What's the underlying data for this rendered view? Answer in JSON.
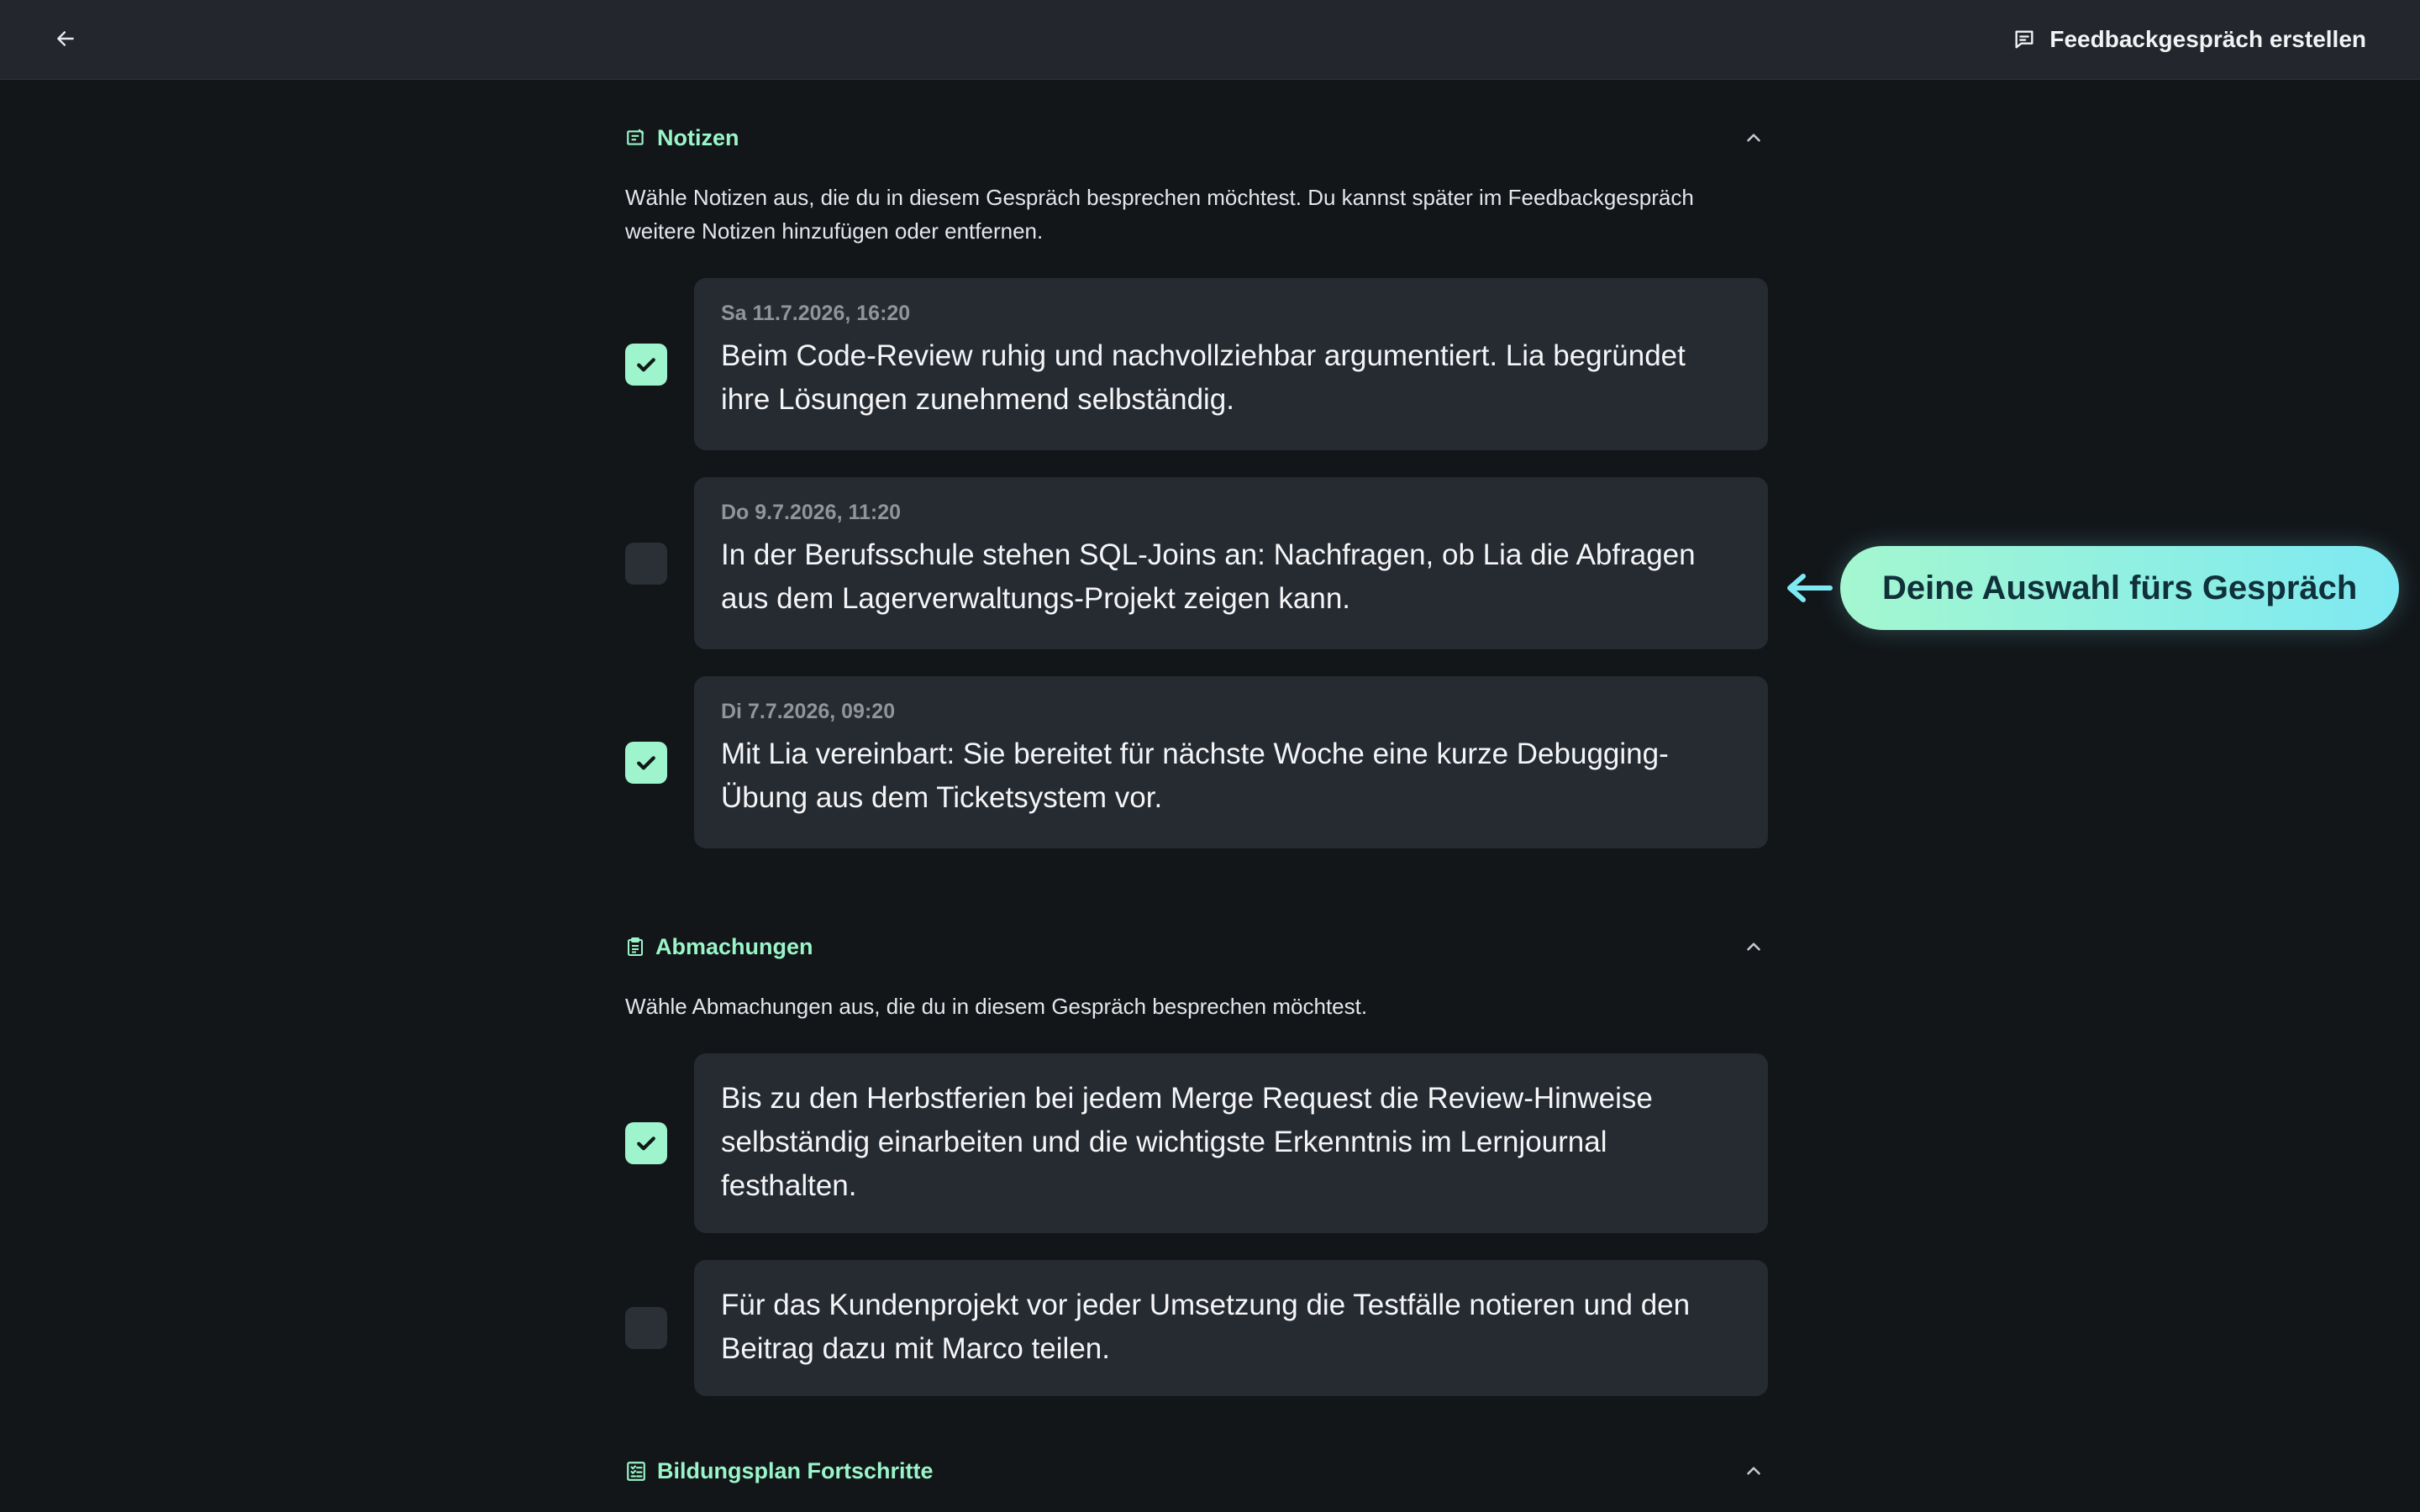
{
  "topbar": {
    "create_label": "Feedbackgespräch erstellen"
  },
  "notes": {
    "title": "Notizen",
    "description": "Wähle Notizen aus, die du in diesem Gespräch besprechen möchtest. Du kannst später im Feedbackgespräch weitere Notizen hinzufügen oder entfernen.",
    "items": [
      {
        "date": "Sa 11.7.2026, 16:20",
        "text": "Beim Code-Review ruhig und nachvollziehbar argumentiert. Lia begründet ihre Lösungen zunehmend selbständig.",
        "checked": true
      },
      {
        "date": "Do 9.7.2026, 11:20",
        "text": "In der Berufsschule stehen SQL-Joins an: Nachfragen, ob Lia die Abfragen aus dem Lagerverwaltungs-Projekt zeigen kann.",
        "checked": false
      },
      {
        "date": "Di 7.7.2026, 09:20",
        "text": "Mit Lia vereinbart: Sie bereitet für nächste Woche eine kurze Debugging-Übung aus dem Ticketsystem vor.",
        "checked": true
      }
    ]
  },
  "agreements": {
    "title": "Abmachungen",
    "description": "Wähle Abmachungen aus, die du in diesem Gespräch besprechen möchtest.",
    "items": [
      {
        "text": "Bis zu den Herbstferien bei jedem Merge Request die Review-Hinweise selbständig einarbeiten und die wichtigste Erkenntnis im Lernjournal festhalten.",
        "checked": true
      },
      {
        "text": "Für das Kundenprojekt vor jeder Umsetzung die Testfälle notieren und den Beitrag dazu mit Marco teilen.",
        "checked": false
      }
    ]
  },
  "progress": {
    "title": "Bildungsplan Fortschritte"
  },
  "callout": {
    "label": "Deine Auswahl fürs Gespräch"
  },
  "colors": {
    "accent": "#9af5c8",
    "background": "#121619",
    "card": "#262a31",
    "topbar": "#23272d"
  },
  "icons": {
    "back": "arrow-left-icon",
    "create": "chat-square-icon",
    "notes": "note-icon",
    "agreements": "clipboard-icon",
    "progress": "checklist-icon",
    "collapse": "chevron-up-icon",
    "check": "checkmark-icon"
  }
}
